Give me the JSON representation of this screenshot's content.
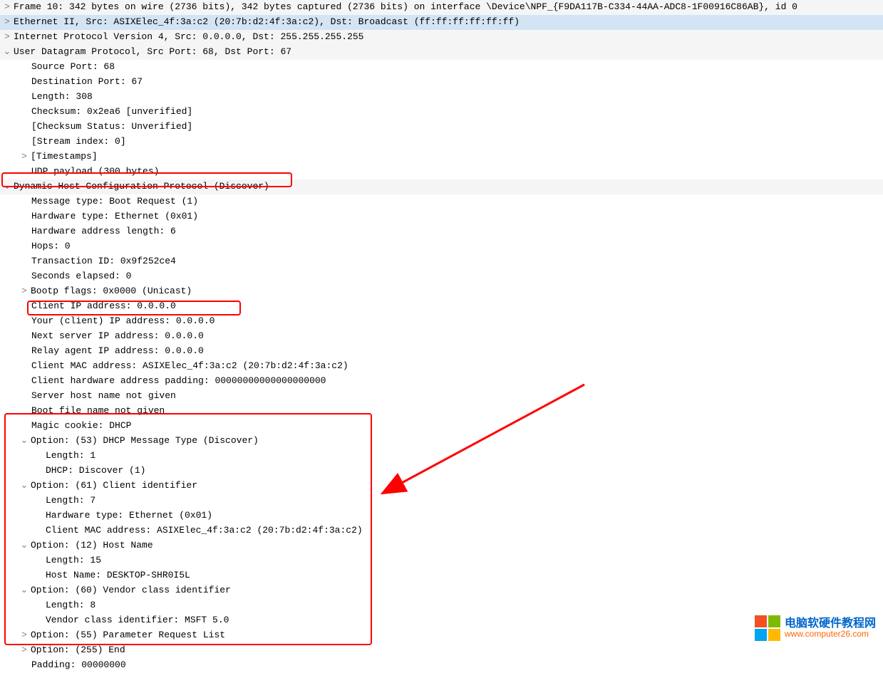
{
  "tree": {
    "frame": "Frame 10: 342 bytes on wire (2736 bits), 342 bytes captured (2736 bits) on interface \\Device\\NPF_{F9DA117B-C334-44AA-ADC8-1F00916C86AB}, id 0",
    "ethernet": "Ethernet II, Src: ASIXElec_4f:3a:c2 (20:7b:d2:4f:3a:c2), Dst: Broadcast (ff:ff:ff:ff:ff:ff)",
    "ip": "Internet Protocol Version 4, Src: 0.0.0.0, Dst: 255.255.255.255",
    "udp": "User Datagram Protocol, Src Port: 68, Dst Port: 67",
    "udp_fields": {
      "srcport": "Source Port: 68",
      "dstport": "Destination Port: 67",
      "length": "Length: 308",
      "checksum": "Checksum: 0x2ea6 [unverified]",
      "checksum_status": "[Checksum Status: Unverified]",
      "stream": "[Stream index: 0]",
      "timestamps": "[Timestamps]",
      "payload": "UDP payload (300 bytes)"
    },
    "dhcp": "Dynamic Host Configuration Protocol (Discover)",
    "dhcp_fields": {
      "msgtype": "Message type: Boot Request (1)",
      "hwtype": "Hardware type: Ethernet (0x01)",
      "hwlen": "Hardware address length: 6",
      "hops": "Hops: 0",
      "xid": "Transaction ID: 0x9f252ce4",
      "secs": "Seconds elapsed: 0",
      "flags": "Bootp flags: 0x0000 (Unicast)",
      "ciaddr": "Client IP address: 0.0.0.0",
      "yiaddr": "Your (client) IP address: 0.0.0.0",
      "siaddr": "Next server IP address: 0.0.0.0",
      "giaddr": "Relay agent IP address: 0.0.0.0",
      "chaddr": "Client MAC address: ASIXElec_4f:3a:c2 (20:7b:d2:4f:3a:c2)",
      "padding": "Client hardware address padding: 00000000000000000000",
      "sname": "Server host name not given",
      "bootfile": "Boot file name not given",
      "cookie": "Magic cookie: DHCP"
    },
    "options": {
      "opt53": "Option: (53) DHCP Message Type (Discover)",
      "opt53_len": "Length: 1",
      "opt53_val": "DHCP: Discover (1)",
      "opt61": "Option: (61) Client identifier",
      "opt61_len": "Length: 7",
      "opt61_hw": "Hardware type: Ethernet (0x01)",
      "opt61_mac": "Client MAC address: ASIXElec_4f:3a:c2 (20:7b:d2:4f:3a:c2)",
      "opt12": "Option: (12) Host Name",
      "opt12_len": "Length: 15",
      "opt12_val": "Host Name: DESKTOP-SHR0I5L",
      "opt60": "Option: (60) Vendor class identifier",
      "opt60_len": "Length: 8",
      "opt60_val": "Vendor class identifier: MSFT 5.0",
      "opt55": "Option: (55) Parameter Request List",
      "opt255": "Option: (255) End",
      "padding": "Padding: 00000000"
    }
  },
  "glyph": {
    "collapsed": ">",
    "expanded": "⌄"
  },
  "watermark": {
    "title": "电脑软硬件教程网",
    "url": "www.computer26.com"
  }
}
